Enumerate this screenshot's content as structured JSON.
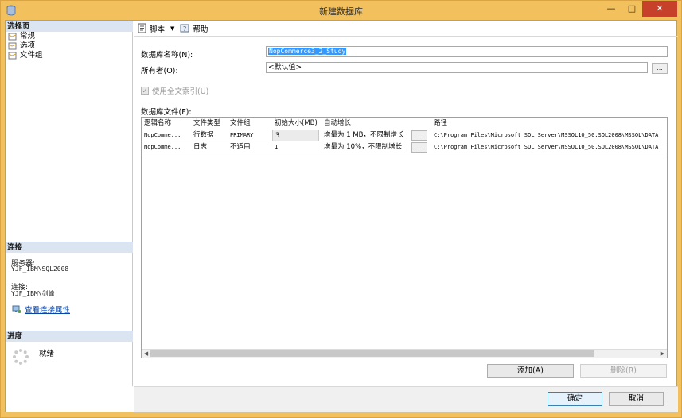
{
  "window": {
    "title": "新建数据库",
    "minimize": "—",
    "maximize": "□",
    "close": "✕",
    "icon": "database-icon"
  },
  "left_pane": {
    "select_page_header": "选择页",
    "pages": [
      {
        "label": "常规",
        "icon": "page-icon"
      },
      {
        "label": "选项",
        "icon": "page-icon"
      },
      {
        "label": "文件组",
        "icon": "page-icon"
      }
    ],
    "connection_header": "连接",
    "server_label": "服务器:",
    "server_value": "YJF_IBM\\SQL2008",
    "connection_label": "连接:",
    "connection_value": "YJF_IBM\\剑峰",
    "view_connection_properties": "查看连接属性",
    "progress_header": "进度",
    "progress_status": "就绪"
  },
  "toolbar": {
    "script_label": "脚本",
    "help_label": "帮助"
  },
  "form": {
    "db_name_label": "数据库名称(N):",
    "db_name_value": "NopCommerce3_2_Study",
    "owner_label": "所有者(O):",
    "owner_value": "<默认值>",
    "browse_label": "...",
    "fulltext_label": "使用全文索引(U)",
    "fulltext_checked": true,
    "db_files_label": "数据库文件(F):"
  },
  "grid": {
    "columns": [
      "逻辑名称",
      "文件类型",
      "文件组",
      "初始大小(MB)",
      "自动增长",
      "路径"
    ],
    "rows": [
      {
        "logical_name": "NopComme...",
        "file_type": "行数据",
        "filegroup": "PRIMARY",
        "initial_size": "3",
        "autogrowth": "增量为 1 MB，不限制增长",
        "autogrowth_button": "...",
        "path": "C:\\Program Files\\Microsoft SQL Server\\MSSQL10_50.SQL2008\\MSSQL\\DATA"
      },
      {
        "logical_name": "NopComme...",
        "file_type": "日志",
        "filegroup": "不适用",
        "initial_size": "1",
        "autogrowth": "增量为 10%，不限制增长",
        "autogrowth_button": "...",
        "path": "C:\\Program Files\\Microsoft SQL Server\\MSSQL10_50.SQL2008\\MSSQL\\DATA"
      }
    ]
  },
  "buttons": {
    "add": "添加(A)",
    "remove": "删除(R)",
    "ok": "确定",
    "cancel": "取消"
  },
  "colors": {
    "window_frame": "#f2c15e",
    "pane_header": "#dbe5f1",
    "selection": "#3399ff",
    "close_button": "#c7402a"
  }
}
